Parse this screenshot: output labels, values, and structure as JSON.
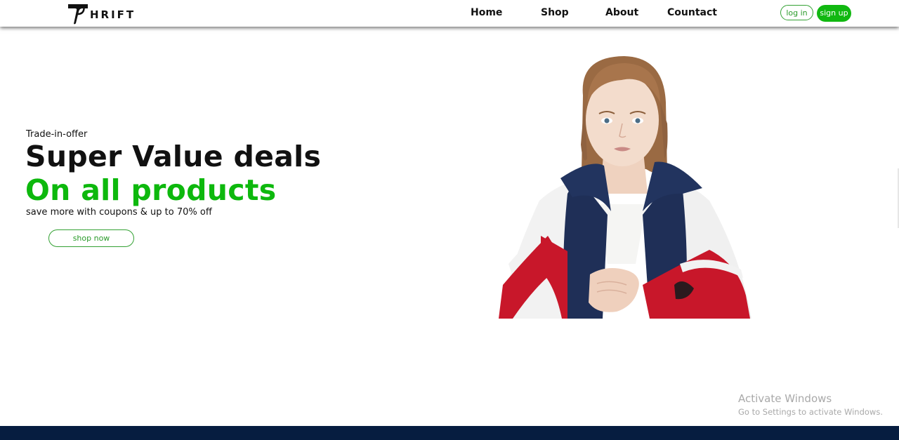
{
  "brand": {
    "logo_text": "HRIFT"
  },
  "nav": {
    "links": [
      "Home",
      "Shop",
      "About",
      "Countact"
    ]
  },
  "auth": {
    "login_label": "log in",
    "signup_label": "sign up"
  },
  "hero": {
    "eyebrow": "Trade-in-offer",
    "title": "Super Value deals",
    "title_accent": "On all products",
    "subtitle": "save more with coupons & up to 70% off",
    "cta_label": "shop now",
    "image_icon": "model-in-jacket-photo"
  },
  "watermark": {
    "title": "Activate Windows",
    "subtitle": "Go to Settings to activate Windows."
  },
  "colors": {
    "accent_green": "#0db80d",
    "text_dark": "#111111",
    "footer_navy": "#061d40",
    "jacket_navy": "#1f2f57",
    "jacket_red": "#c8172a"
  }
}
